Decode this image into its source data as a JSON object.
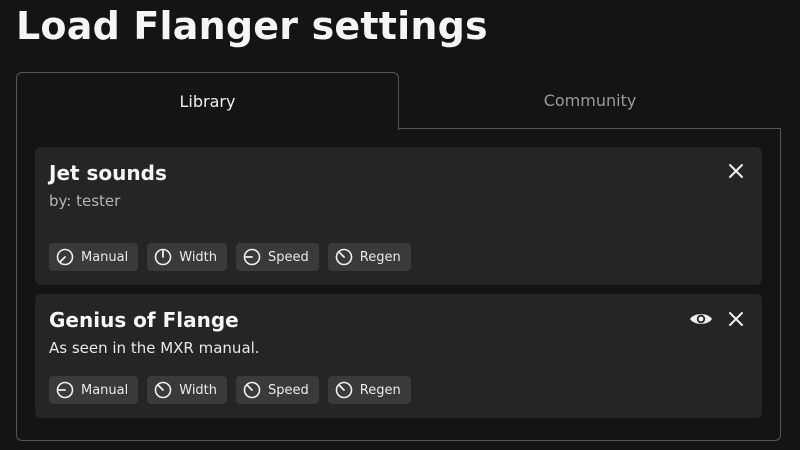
{
  "page": {
    "title": "Load Flanger settings"
  },
  "tabs": [
    {
      "label": "Library",
      "active": true
    },
    {
      "label": "Community",
      "active": false
    }
  ],
  "presets": [
    {
      "title": "Jet sounds",
      "subtitle": "by: tester",
      "controls": [
        {
          "label": "Manual",
          "icon": "knob-icon",
          "knob_angle": 225
        },
        {
          "label": "Width",
          "icon": "knob-icon",
          "knob_angle": 0
        },
        {
          "label": "Speed",
          "icon": "knob-icon",
          "knob_angle": 270
        },
        {
          "label": "Regen",
          "icon": "knob-icon",
          "knob_angle": 315
        }
      ],
      "actions": [
        "close-icon"
      ]
    },
    {
      "title": "Genius of Flange",
      "subtitle": "As seen in the MXR manual.",
      "controls": [
        {
          "label": "Manual",
          "icon": "knob-icon",
          "knob_angle": 270
        },
        {
          "label": "Width",
          "icon": "knob-icon",
          "knob_angle": 315
        },
        {
          "label": "Speed",
          "icon": "knob-icon",
          "knob_angle": 315
        },
        {
          "label": "Regen",
          "icon": "knob-icon",
          "knob_angle": 315
        }
      ],
      "actions": [
        "eye-icon",
        "close-icon"
      ]
    }
  ],
  "colors": {
    "background": "#141414",
    "card": "#252525",
    "chip": "#3a3a3a",
    "border": "#555555",
    "text": "#f2f2f2",
    "muted": "#9a9a9a"
  }
}
